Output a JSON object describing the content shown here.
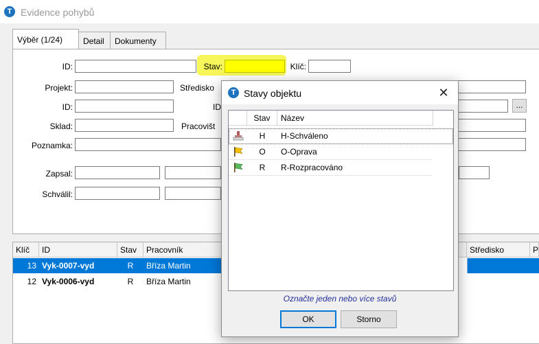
{
  "window": {
    "title": "Evidence pohybů"
  },
  "tabs": [
    {
      "label": "Výběr (1/24)"
    },
    {
      "label": "Detail"
    },
    {
      "label": "Dokumenty"
    }
  ],
  "form": {
    "id_label": "ID:",
    "stav_label": "Stav:",
    "klic_label": "Klíč:",
    "projekt_label": "Projekt:",
    "stredisko_label": "Středisko",
    "id2_label": "ID:",
    "id3_label": "ID",
    "sklad_label": "Sklad:",
    "pracoviste_label": "Pracovišt",
    "poznamka_label": "Poznamka:",
    "zapsal_label": "Zapsal:",
    "schvalil_label": "Schválil:",
    "browse_label": "..."
  },
  "grid": {
    "columns": [
      "Klíč",
      "ID",
      "Stav",
      "Pracovník",
      "Středisko",
      "P"
    ],
    "rows": [
      {
        "klic": "13",
        "id": "Vyk-0007-vyd",
        "stav": "R",
        "pracovnik": "Bříza Martin",
        "selected": true
      },
      {
        "klic": "12",
        "id": "Vyk-0006-vyd",
        "stav": "R",
        "pracovnik": "Bříza Martin",
        "selected": false
      }
    ]
  },
  "dialog": {
    "title": "Stavy objektu",
    "close": "✕",
    "columns": [
      "Stav",
      "Název"
    ],
    "items": [
      {
        "stav": "H",
        "nazev": "H-Schváleno",
        "icon": "stamp-icon"
      },
      {
        "stav": "O",
        "nazev": "O-Oprava",
        "icon": "yellow-flag-icon"
      },
      {
        "stav": "R",
        "nazev": "R-Rozpracováno",
        "icon": "green-flag-icon"
      }
    ],
    "hint": "Označte jeden nebo více stavů",
    "ok": "OK",
    "cancel": "Storno"
  },
  "colors": {
    "accent": "#0078d7",
    "highlight": "#ffff00",
    "hint": "#23309a"
  }
}
